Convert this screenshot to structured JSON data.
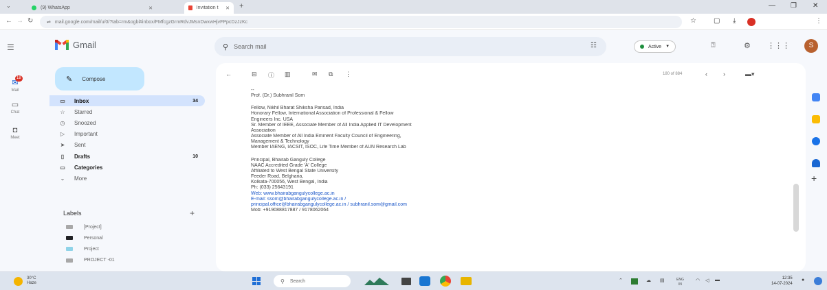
{
  "browser": {
    "tabs": [
      {
        "title": "(9) WhatsApp",
        "active": false
      },
      {
        "title": "Invitation to attend in the proce",
        "active": true
      }
    ],
    "url": "mail.google.com/mail/u/0/?tab=rm&ogbl#inbox/FMfcgzGrmRdvJMsnDwxwHjvFPpcDzJzKc"
  },
  "gmail": {
    "app_name": "Gmail",
    "search_placeholder": "Search mail",
    "status": "Active",
    "compose_label": "Compose",
    "rail": [
      {
        "icon": "mail-icon",
        "label": "Mail",
        "badge": "18"
      },
      {
        "icon": "chat-icon",
        "label": "Chat"
      },
      {
        "icon": "meet-icon",
        "label": "Meet"
      }
    ],
    "nav": [
      {
        "icon": "inbox-icon",
        "glyph": "▭",
        "label": "Inbox",
        "count": "34",
        "selected": true
      },
      {
        "icon": "star-icon",
        "glyph": "☆",
        "label": "Starred"
      },
      {
        "icon": "clock-icon",
        "glyph": "◷",
        "label": "Snoozed"
      },
      {
        "icon": "important-icon",
        "glyph": "▷",
        "label": "Important"
      },
      {
        "icon": "send-icon",
        "glyph": "➤",
        "label": "Sent"
      },
      {
        "icon": "draft-icon",
        "glyph": "▯",
        "label": "Drafts",
        "count": "10",
        "bold": true
      },
      {
        "icon": "category-icon",
        "glyph": "▭",
        "label": "Categories",
        "bold": true
      },
      {
        "icon": "more-icon",
        "glyph": "⌄",
        "label": "More"
      }
    ],
    "labels_heading": "Labels",
    "labels": [
      {
        "name": "[Project]",
        "color": "#a8a8a8"
      },
      {
        "name": "Personal",
        "color": "#202124"
      },
      {
        "name": "Project",
        "color": "#8fd3e8"
      },
      {
        "name": "PROJECT -01",
        "color": "#a8a8a8"
      }
    ],
    "page_count": "180 of 884",
    "email_lines": [
      "--",
      "Prof. (Dr.) Subhranil Som",
      "",
      "Fellow, Nikhil Bharat Shiksha Parisad, India",
      "Honorary Fellow, International Association of Professional & Fellow",
      "Engineers Inc. USA",
      "Sr. Member of IEEE, Associate Member of All India Applied IT Development",
      "Association",
      "Associate Member of All India Eminent Faculty Council of Engineering,",
      "Management & Technology",
      "Member IAENG, IACSIT, ISOC, Life Time Member of AUN Research Lab",
      "",
      "Principal, Bhairab Ganguly College",
      "NAAC Accredited Grade 'A' College",
      "Affiliated to West Bengal State University",
      "Feeder Road, Belgharia,",
      "Kolkata-700056, West Bengal, India",
      "Ph: (033) 25643191",
      "Web: www.bhairabgangulycollege.ac.in",
      "E-mail: ssom@bhairabgangulycollege.ac.in /",
      "principal.office@bhairabgangulycollege.ac.in / subhranil.som@gmail.com",
      "Mob: +919088817887 / 9178062064"
    ],
    "link_lines": [
      18,
      19,
      20
    ]
  },
  "taskbar": {
    "weather_temp": "30°C",
    "weather_desc": "Haze",
    "search_label": "Search",
    "lang": "ENG",
    "region": "IN",
    "time": "12:35",
    "date": "14-07-2024"
  }
}
